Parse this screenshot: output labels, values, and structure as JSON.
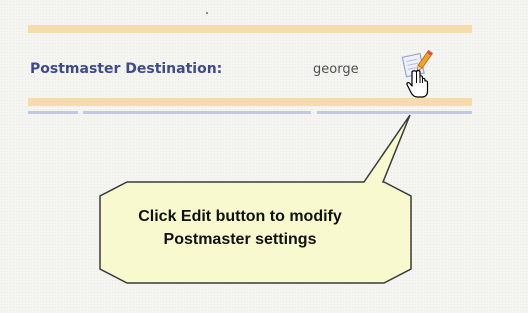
{
  "setting": {
    "label": "Postmaster Destination:",
    "value": "george"
  },
  "edit_button": {
    "icon": "edit-icon",
    "cursor": "hand-pointer-icon"
  },
  "callout": {
    "line1": "Click Edit button to modify",
    "line2": "Postmaster settings"
  },
  "colors": {
    "label": "#3e4a8e",
    "rule_orange": "#f7dcab",
    "rule_blue": "#bfc8e4",
    "callout_fill": "#f9f9cf",
    "callout_border": "#3a3a3a"
  }
}
